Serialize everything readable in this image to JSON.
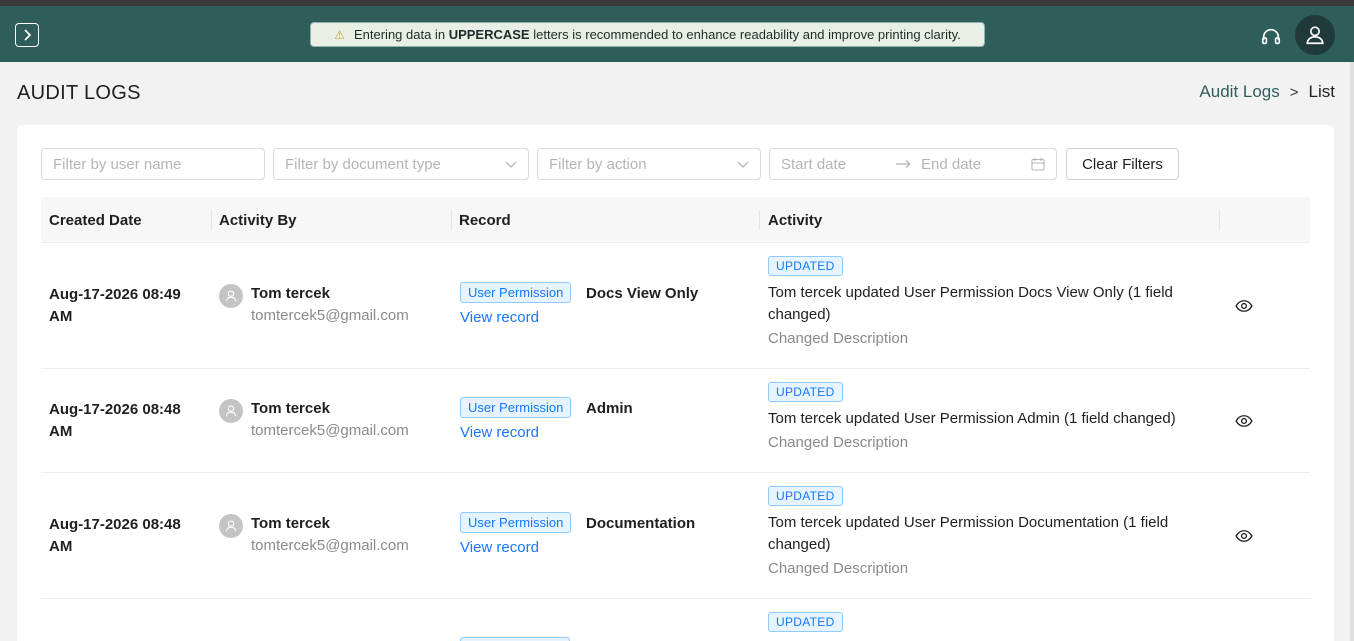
{
  "topbar": {
    "notice_prefix": "Entering data in",
    "notice_bold": "UPPERCASE",
    "notice_suffix": "letters is recommended to enhance readability and improve printing clarity."
  },
  "page": {
    "title": "AUDIT LOGS",
    "breadcrumb": {
      "link": "Audit Logs",
      "separator": ">",
      "current": "List"
    }
  },
  "filters": {
    "user_name_placeholder": "Filter by user name",
    "document_type_placeholder": "Filter by document type",
    "action_placeholder": "Filter by action",
    "start_date_placeholder": "Start date",
    "end_date_placeholder": "End date",
    "clear_label": "Clear Filters"
  },
  "table": {
    "headers": [
      "Created Date",
      "Activity By",
      "Record",
      "Activity"
    ],
    "rows": [
      {
        "date_line1": "Aug-17-2026 08:49",
        "date_line2": "AM",
        "user_name": "Tom tercek",
        "user_email": "tomtercek5@gmail.com",
        "record_tag": "User Permission",
        "record_link": "View record",
        "record_name": "Docs View Only",
        "action_badge": "UPDATED",
        "activity": "Tom tercek updated User Permission Docs View Only (1 field changed)",
        "activity_sub": "Changed Description"
      },
      {
        "date_line1": "Aug-17-2026 08:48",
        "date_line2": "AM",
        "user_name": "Tom tercek",
        "user_email": "tomtercek5@gmail.com",
        "record_tag": "User Permission",
        "record_link": "View record",
        "record_name": "Admin",
        "action_badge": "UPDATED",
        "activity": "Tom tercek updated User Permission Admin (1 field changed)",
        "activity_sub": "Changed Description"
      },
      {
        "date_line1": "Aug-17-2026 08:48",
        "date_line2": "AM",
        "user_name": "Tom tercek",
        "user_email": "tomtercek5@gmail.com",
        "record_tag": "User Permission",
        "record_link": "View record",
        "record_name": "Documentation",
        "action_badge": "UPDATED",
        "activity": "Tom tercek updated User Permission Documentation (1 field changed)",
        "activity_sub": "Changed Description"
      },
      {
        "action_badge": "UPDATED"
      }
    ]
  },
  "icons": {
    "sidebar_toggle": "chevron-right-icon",
    "notice": "warning-icon",
    "support": "headset-icon",
    "profile": "user-icon",
    "row_view": "eye-icon",
    "calendar": "calendar-icon"
  }
}
